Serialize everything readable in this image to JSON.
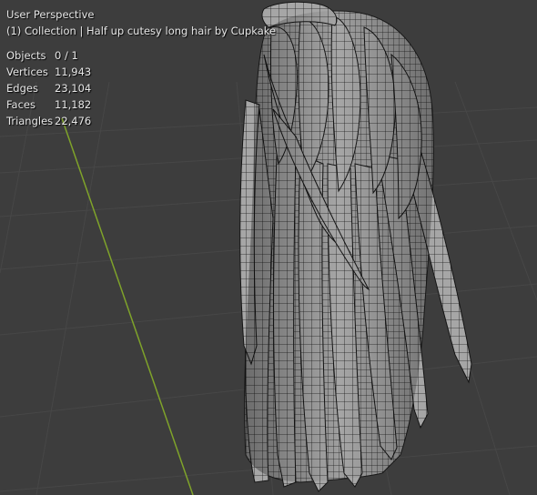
{
  "viewport": {
    "view_name": "User Perspective",
    "collection_info": "(1) Collection | Half up cutesy long hair by Cupkake",
    "stats": [
      {
        "label": "Objects",
        "value": "0 / 1"
      },
      {
        "label": "Vertices",
        "value": "11,943"
      },
      {
        "label": "Edges",
        "value": "23,104"
      },
      {
        "label": "Faces",
        "value": "11,182"
      },
      {
        "label": "Triangles",
        "value": "22,476"
      }
    ],
    "object": "hair-mesh",
    "colors": {
      "background": "#3d3d3d",
      "grid": "#4a4a4a",
      "y_axis": "#7fa32a",
      "mesh_fill": "#a8a8a8",
      "wire": "#1a1a1a"
    }
  }
}
